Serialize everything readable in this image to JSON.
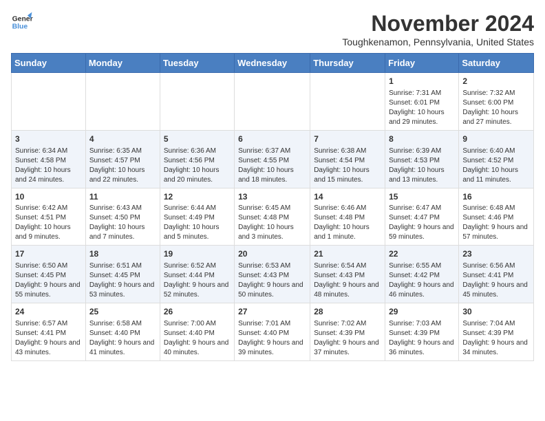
{
  "header": {
    "logo_line1": "General",
    "logo_line2": "Blue",
    "month_title": "November 2024",
    "location": "Toughkenamon, Pennsylvania, United States"
  },
  "days_of_week": [
    "Sunday",
    "Monday",
    "Tuesday",
    "Wednesday",
    "Thursday",
    "Friday",
    "Saturday"
  ],
  "weeks": [
    {
      "days": [
        {
          "num": "",
          "data": ""
        },
        {
          "num": "",
          "data": ""
        },
        {
          "num": "",
          "data": ""
        },
        {
          "num": "",
          "data": ""
        },
        {
          "num": "",
          "data": ""
        },
        {
          "num": "1",
          "data": "Sunrise: 7:31 AM\nSunset: 6:01 PM\nDaylight: 10 hours and 29 minutes."
        },
        {
          "num": "2",
          "data": "Sunrise: 7:32 AM\nSunset: 6:00 PM\nDaylight: 10 hours and 27 minutes."
        }
      ]
    },
    {
      "days": [
        {
          "num": "3",
          "data": "Sunrise: 6:34 AM\nSunset: 4:58 PM\nDaylight: 10 hours and 24 minutes."
        },
        {
          "num": "4",
          "data": "Sunrise: 6:35 AM\nSunset: 4:57 PM\nDaylight: 10 hours and 22 minutes."
        },
        {
          "num": "5",
          "data": "Sunrise: 6:36 AM\nSunset: 4:56 PM\nDaylight: 10 hours and 20 minutes."
        },
        {
          "num": "6",
          "data": "Sunrise: 6:37 AM\nSunset: 4:55 PM\nDaylight: 10 hours and 18 minutes."
        },
        {
          "num": "7",
          "data": "Sunrise: 6:38 AM\nSunset: 4:54 PM\nDaylight: 10 hours and 15 minutes."
        },
        {
          "num": "8",
          "data": "Sunrise: 6:39 AM\nSunset: 4:53 PM\nDaylight: 10 hours and 13 minutes."
        },
        {
          "num": "9",
          "data": "Sunrise: 6:40 AM\nSunset: 4:52 PM\nDaylight: 10 hours and 11 minutes."
        }
      ]
    },
    {
      "days": [
        {
          "num": "10",
          "data": "Sunrise: 6:42 AM\nSunset: 4:51 PM\nDaylight: 10 hours and 9 minutes."
        },
        {
          "num": "11",
          "data": "Sunrise: 6:43 AM\nSunset: 4:50 PM\nDaylight: 10 hours and 7 minutes."
        },
        {
          "num": "12",
          "data": "Sunrise: 6:44 AM\nSunset: 4:49 PM\nDaylight: 10 hours and 5 minutes."
        },
        {
          "num": "13",
          "data": "Sunrise: 6:45 AM\nSunset: 4:48 PM\nDaylight: 10 hours and 3 minutes."
        },
        {
          "num": "14",
          "data": "Sunrise: 6:46 AM\nSunset: 4:48 PM\nDaylight: 10 hours and 1 minute."
        },
        {
          "num": "15",
          "data": "Sunrise: 6:47 AM\nSunset: 4:47 PM\nDaylight: 9 hours and 59 minutes."
        },
        {
          "num": "16",
          "data": "Sunrise: 6:48 AM\nSunset: 4:46 PM\nDaylight: 9 hours and 57 minutes."
        }
      ]
    },
    {
      "days": [
        {
          "num": "17",
          "data": "Sunrise: 6:50 AM\nSunset: 4:45 PM\nDaylight: 9 hours and 55 minutes."
        },
        {
          "num": "18",
          "data": "Sunrise: 6:51 AM\nSunset: 4:45 PM\nDaylight: 9 hours and 53 minutes."
        },
        {
          "num": "19",
          "data": "Sunrise: 6:52 AM\nSunset: 4:44 PM\nDaylight: 9 hours and 52 minutes."
        },
        {
          "num": "20",
          "data": "Sunrise: 6:53 AM\nSunset: 4:43 PM\nDaylight: 9 hours and 50 minutes."
        },
        {
          "num": "21",
          "data": "Sunrise: 6:54 AM\nSunset: 4:43 PM\nDaylight: 9 hours and 48 minutes."
        },
        {
          "num": "22",
          "data": "Sunrise: 6:55 AM\nSunset: 4:42 PM\nDaylight: 9 hours and 46 minutes."
        },
        {
          "num": "23",
          "data": "Sunrise: 6:56 AM\nSunset: 4:41 PM\nDaylight: 9 hours and 45 minutes."
        }
      ]
    },
    {
      "days": [
        {
          "num": "24",
          "data": "Sunrise: 6:57 AM\nSunset: 4:41 PM\nDaylight: 9 hours and 43 minutes."
        },
        {
          "num": "25",
          "data": "Sunrise: 6:58 AM\nSunset: 4:40 PM\nDaylight: 9 hours and 41 minutes."
        },
        {
          "num": "26",
          "data": "Sunrise: 7:00 AM\nSunset: 4:40 PM\nDaylight: 9 hours and 40 minutes."
        },
        {
          "num": "27",
          "data": "Sunrise: 7:01 AM\nSunset: 4:40 PM\nDaylight: 9 hours and 39 minutes."
        },
        {
          "num": "28",
          "data": "Sunrise: 7:02 AM\nSunset: 4:39 PM\nDaylight: 9 hours and 37 minutes."
        },
        {
          "num": "29",
          "data": "Sunrise: 7:03 AM\nSunset: 4:39 PM\nDaylight: 9 hours and 36 minutes."
        },
        {
          "num": "30",
          "data": "Sunrise: 7:04 AM\nSunset: 4:39 PM\nDaylight: 9 hours and 34 minutes."
        }
      ]
    }
  ]
}
